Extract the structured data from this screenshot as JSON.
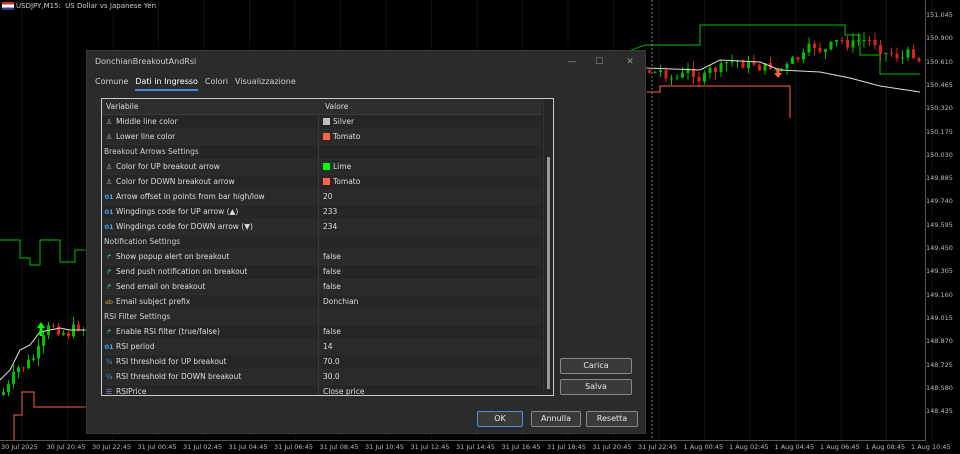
{
  "chart": {
    "symbol": "USDJPY",
    "timeframe": "M15",
    "description": "US Dollar vs Japanese Yen",
    "price_labels": [
      "151.045",
      "150.900",
      "150.610",
      "150.465",
      "150.320",
      "150.175",
      "150.030",
      "149.885",
      "149.740",
      "149.595",
      "149.450",
      "149.305",
      "149.160",
      "149.015",
      "148.870",
      "148.725",
      "148.580",
      "148.435"
    ],
    "time_labels": [
      "30 Jul 2025",
      "30 Jul 20:45",
      "30 Jul 22:45",
      "31 Jul 00:45",
      "31 Jul 02:45",
      "31 Jul 04:45",
      "31 Jul 06:45",
      "31 Jul 08:45",
      "31 Jul 10:45",
      "31 Jul 12:45",
      "31 Jul 14:45",
      "31 Jul 16:45",
      "31 Jul 18:45",
      "31 Jul 20:45",
      "31 Jul 22:45",
      "1 Aug 00:45",
      "1 Aug 02:45",
      "1 Aug 04:45",
      "1 Aug 06:45",
      "1 Aug 08:45",
      "1 Aug 10:45"
    ],
    "colors": {
      "upper": "#00c000",
      "middle": "#c0c0c0",
      "lower": "#ff6347",
      "up_arrow": "#00ff00",
      "down_arrow": "#ff6347"
    }
  },
  "dialog": {
    "title": "DonchianBreakoutAndRsi",
    "tabs": [
      {
        "label": "Comune",
        "active": false
      },
      {
        "label": "Dati in Ingresso",
        "active": true
      },
      {
        "label": "Colori",
        "active": false
      },
      {
        "label": "Visualizzazione",
        "active": false
      }
    ],
    "columns": {
      "variable": "Variabile",
      "value": "Valore"
    },
    "rows": [
      {
        "type": "color",
        "name": "Middle line color",
        "value": "Silver",
        "swatch": "#c0c0c0"
      },
      {
        "type": "color",
        "name": "Lower line color",
        "value": "Tomato",
        "swatch": "#ff6347"
      },
      {
        "type": "group",
        "name": "Breakout Arrows Settings",
        "value": ""
      },
      {
        "type": "color",
        "name": "Color for UP breakout arrow",
        "value": "Lime",
        "swatch": "#00ff00"
      },
      {
        "type": "color",
        "name": "Color for DOWN breakout arrow",
        "value": "Tomato",
        "swatch": "#ff6347"
      },
      {
        "type": "int",
        "name": "Arrow offset in points from bar high/low",
        "value": "20"
      },
      {
        "type": "int",
        "name": "Wingdings code for UP arrow (▲)",
        "value": "233"
      },
      {
        "type": "int",
        "name": "Wingdings code for DOWN arrow (▼)",
        "value": "234"
      },
      {
        "type": "group",
        "name": "Notification Settings",
        "value": ""
      },
      {
        "type": "bool",
        "name": "Show popup alert on breakout",
        "value": "false"
      },
      {
        "type": "bool",
        "name": "Send push notification on breakout",
        "value": "false"
      },
      {
        "type": "bool",
        "name": "Send email on breakout",
        "value": "false"
      },
      {
        "type": "str",
        "name": "Email subject prefix",
        "value": "Donchian"
      },
      {
        "type": "group",
        "name": "RSI Filter Settings",
        "value": ""
      },
      {
        "type": "bool",
        "name": "Enable RSI filter (true/false)",
        "value": "false"
      },
      {
        "type": "int",
        "name": "RSI period",
        "value": "14"
      },
      {
        "type": "dbl",
        "name": "RSI threshold for UP breakout",
        "value": "70.0"
      },
      {
        "type": "dbl",
        "name": "RSI threshold for DOWN breakout",
        "value": "30.0"
      },
      {
        "type": "enum",
        "name": "RSIPrice",
        "value": "Close price"
      }
    ],
    "buttons": {
      "load": "Carica",
      "save": "Salva",
      "ok": "OK",
      "cancel": "Annulla",
      "reset": "Resetta"
    }
  }
}
